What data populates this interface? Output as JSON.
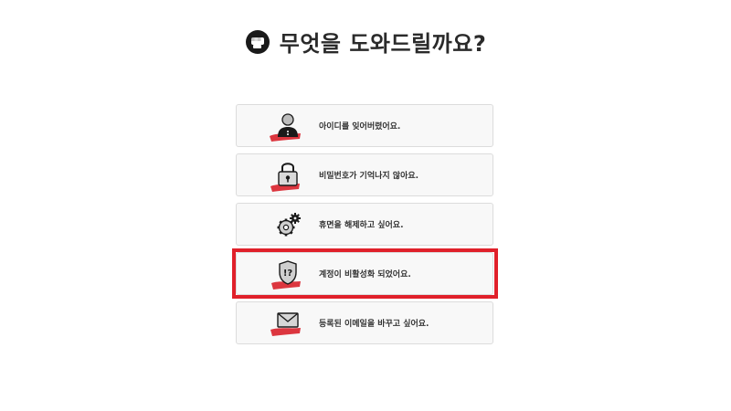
{
  "header": {
    "title": "무엇을 도와드릴까요?",
    "logo_icon": "fist-logo-icon"
  },
  "options": [
    {
      "label": "아이디를 잊어버렸어요.",
      "icon": "user-person-icon"
    },
    {
      "label": "비밀번호가 기억나지 않아요.",
      "icon": "padlock-icon"
    },
    {
      "label": "휴면을 해제하고 싶어요.",
      "icon": "gears-icon"
    },
    {
      "label": "계정이 비활성화 되었어요.",
      "icon": "shield-alert-icon"
    },
    {
      "label": "등록된 이메일을 바꾸고 싶어요.",
      "icon": "envelope-icon"
    }
  ],
  "highlight": {
    "selected_index": 3,
    "color": "#e0202a"
  },
  "colors": {
    "accent_red": "#d8202a",
    "text": "#333333",
    "card_bg": "#f8f8f8",
    "card_border": "#dcdcdc"
  }
}
